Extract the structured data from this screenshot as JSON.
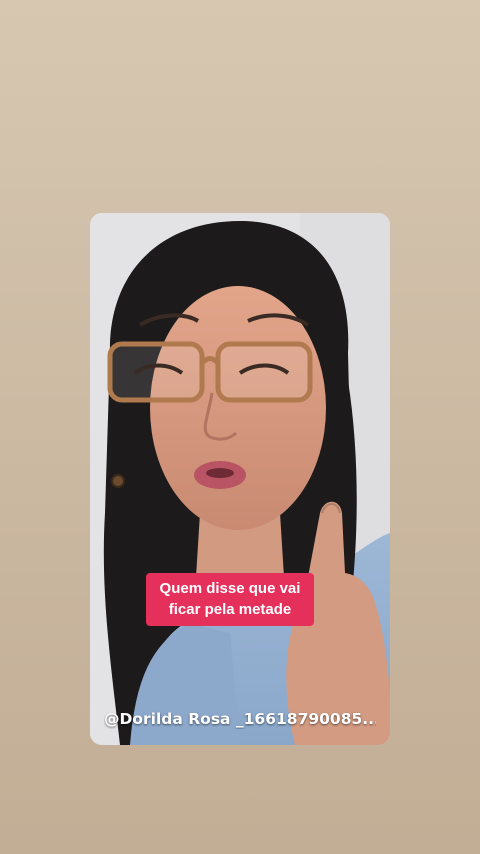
{
  "story": {
    "background_colors": [
      "#d7c7b1",
      "#c2ad95"
    ],
    "video": {
      "icon": "person-video-frame"
    },
    "caption": {
      "line1": "Quem disse que vai",
      "line2": "ficar pela metade",
      "background_color": "#e6305c",
      "text_color": "#ffffff"
    },
    "mention": {
      "text": "@Dorilda Rosa _16618790085..."
    }
  }
}
